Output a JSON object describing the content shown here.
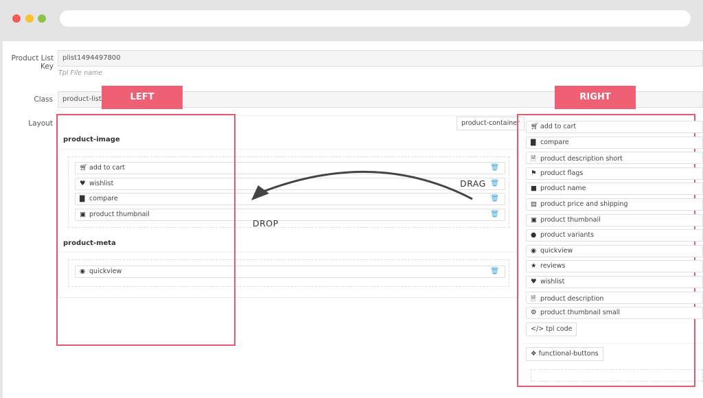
{
  "browser": {
    "dot_colors": [
      "#f25c54",
      "#f9c22e",
      "#8bc34a"
    ]
  },
  "form": {
    "product_list_key_label": "Product List Key",
    "product_list_key_value": "plist1494497800",
    "tpl_hint": "Tpl File name",
    "class_label": "Class",
    "class_value": "product-list-1",
    "layout_label": "Layout",
    "container_label": "product-container"
  },
  "left": {
    "tag": "LEFT",
    "groups": [
      {
        "title": "product-image",
        "items": [
          {
            "label": "add to cart",
            "icon": "cart-icon"
          },
          {
            "label": "wishlist",
            "icon": "heart-icon"
          },
          {
            "label": "compare",
            "icon": "bar-chart-icon"
          },
          {
            "label": "product thumbnail",
            "icon": "image-icon"
          }
        ]
      },
      {
        "title": "product-meta",
        "items": [
          {
            "label": "quickview",
            "icon": "eye-icon"
          }
        ]
      }
    ]
  },
  "right": {
    "tag": "RIGHT",
    "items": [
      {
        "label": "add to cart",
        "icon": "cart-icon"
      },
      {
        "label": "compare",
        "icon": "bar-chart-icon"
      },
      {
        "label": "product description short",
        "icon": "document-icon"
      },
      {
        "label": "product flags",
        "icon": "flag-icon"
      },
      {
        "label": "product name",
        "icon": "file-icon"
      },
      {
        "label": "product price and shipping",
        "icon": "money-icon"
      },
      {
        "label": "product thumbnail",
        "icon": "image-icon"
      },
      {
        "label": "product variants",
        "icon": "circle-icon"
      },
      {
        "label": "quickview",
        "icon": "eye-icon"
      },
      {
        "label": "reviews",
        "icon": "star-icon"
      },
      {
        "label": "wishlist",
        "icon": "heart-icon"
      },
      {
        "label": "product description",
        "icon": "document-icon"
      },
      {
        "label": "product thumbnail small",
        "icon": "gear-icon"
      }
    ],
    "tpl_code": "tpl code",
    "functional_buttons": "functional-buttons"
  },
  "annotations": {
    "drag": "DRAG",
    "drop": "DROP"
  },
  "colors": {
    "accent_red": "#e8596e",
    "tag_bg": "#f06075",
    "trash_blue": "#3aa5d8"
  }
}
